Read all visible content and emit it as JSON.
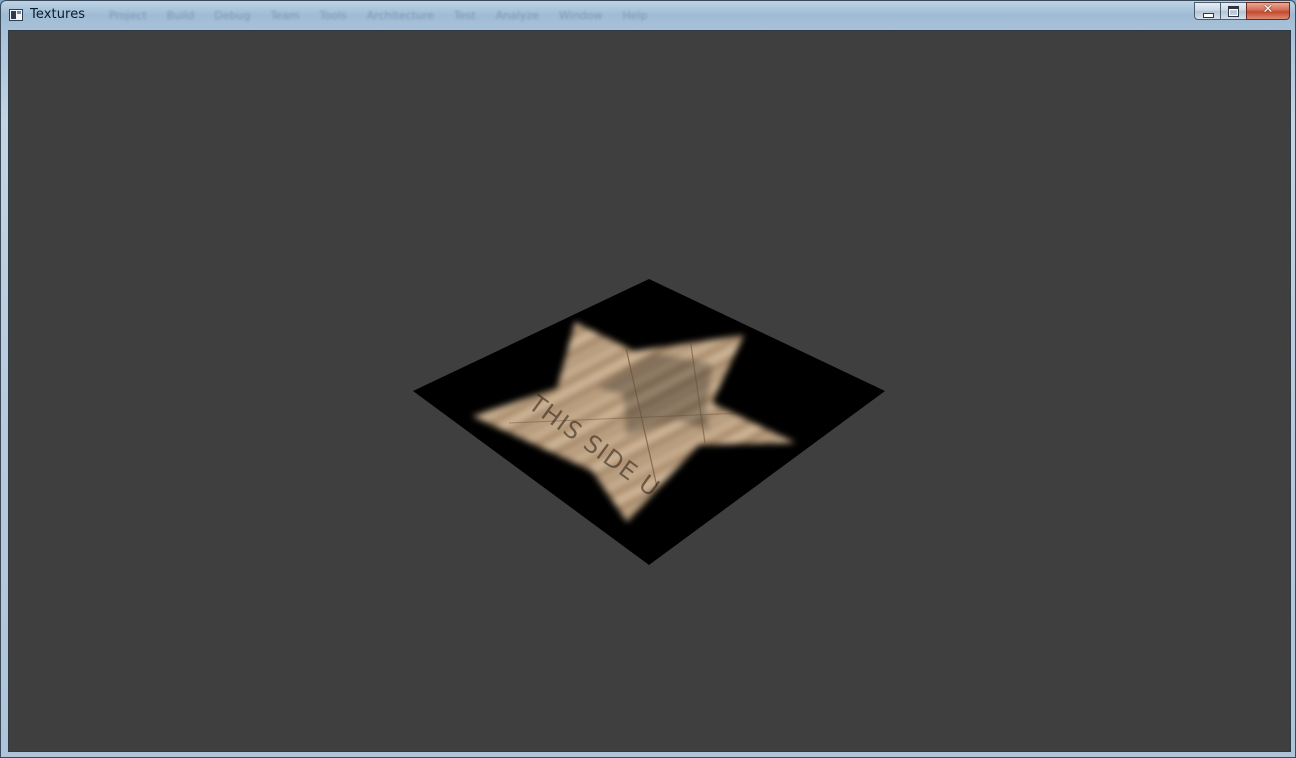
{
  "window": {
    "title": "Textures",
    "menu_ghost": [
      "Project",
      "Build",
      "Debug",
      "Team",
      "Tools",
      "Architecture",
      "Test",
      "Analyze",
      "Window",
      "Help"
    ]
  },
  "caption": {
    "close_glyph": "✕"
  },
  "scene": {
    "background_color": "#3f3f3f",
    "plane_color": "#000000",
    "texture_text": "THIS SIDE UP"
  },
  "colors": {
    "frame_accent": "#aec4d8",
    "close_red": "#c44a2f"
  }
}
